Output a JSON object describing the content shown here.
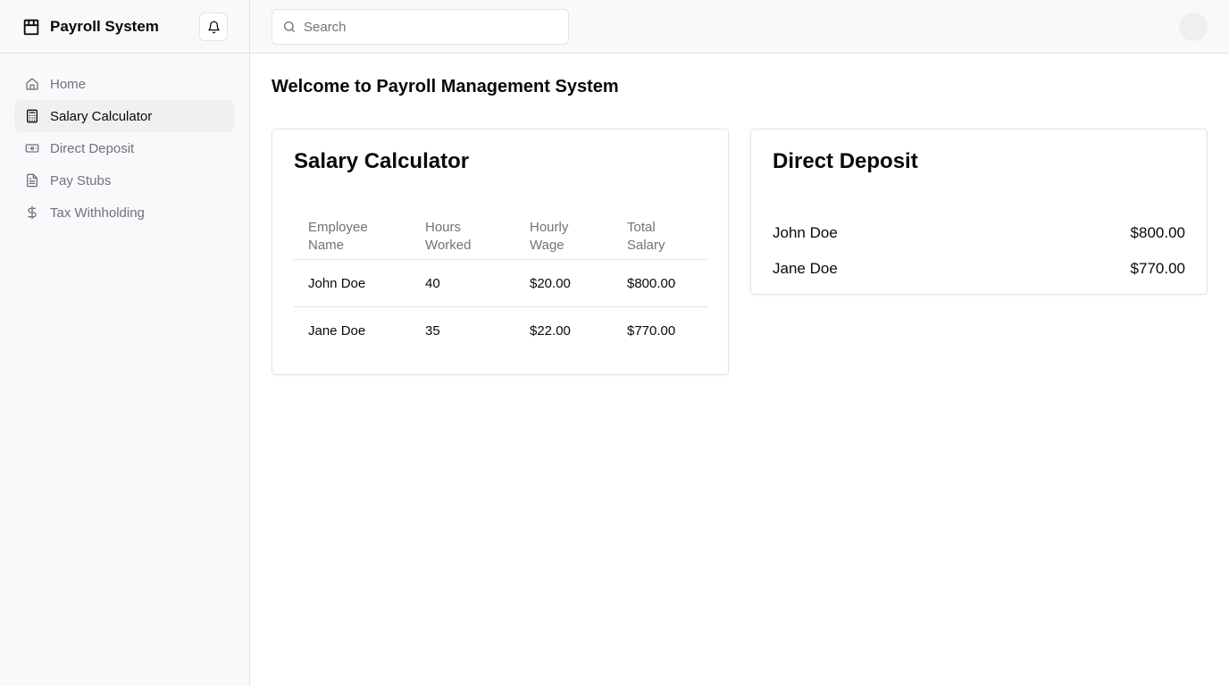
{
  "app": {
    "title": "Payroll System",
    "brand_icon": "package-icon"
  },
  "sidebar": {
    "items": [
      {
        "label": "Home",
        "icon": "home-icon",
        "active": false
      },
      {
        "label": "Salary Calculator",
        "icon": "calculator-icon",
        "active": true
      },
      {
        "label": "Direct Deposit",
        "icon": "banknote-icon",
        "active": false
      },
      {
        "label": "Pay Stubs",
        "icon": "file-text-icon",
        "active": false
      },
      {
        "label": "Tax Withholding",
        "icon": "dollar-sign-icon",
        "active": false
      }
    ]
  },
  "header": {
    "search": {
      "placeholder": "Search",
      "value": ""
    }
  },
  "main": {
    "title": "Welcome to Payroll Management System",
    "salary_calculator": {
      "title": "Salary Calculator",
      "columns": [
        "Employee Name",
        "Hours Worked",
        "Hourly Wage",
        "Total Salary"
      ],
      "rows": [
        [
          "John Doe",
          "40",
          "$20.00",
          "$800.00"
        ],
        [
          "Jane Doe",
          "35",
          "$22.00",
          "$770.00"
        ]
      ]
    },
    "direct_deposit": {
      "title": "Direct Deposit",
      "items": [
        {
          "name": "John Doe",
          "amount": "$800.00"
        },
        {
          "name": "Jane Doe",
          "amount": "$770.00"
        }
      ]
    }
  },
  "colors": {
    "sidebar_bg": "#f8f9fa",
    "active_item_bg": "#eff0f2",
    "border": "#e4e4e7",
    "muted_text": "#71717a",
    "text": "#09090b"
  }
}
